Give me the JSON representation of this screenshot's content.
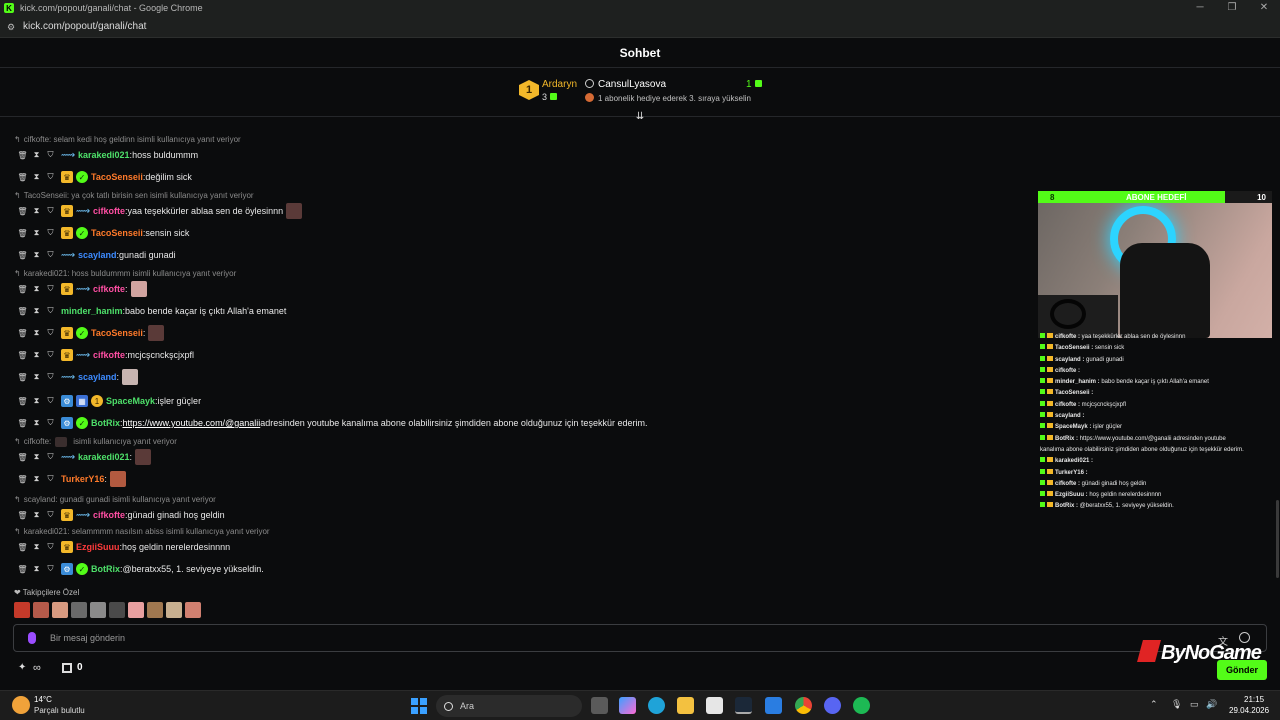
{
  "window": {
    "title": "kick.com/popout/ganali/chat - Google Chrome",
    "url": "kick.com/popout/ganali/chat"
  },
  "header": {
    "title": "Sohbet"
  },
  "gift_banner": {
    "top_gifter": "Ardaryn",
    "top_gifter_rank": "1",
    "top_gifter_count": "3",
    "event_user": "CansulLyasova",
    "event_message": "1 abonelik hediye ederek 3. sıraya yükselin",
    "event_count": "1"
  },
  "colors": {
    "kick_green": "#53fc18",
    "crown_gold": "#f3b82a",
    "background": "#0b0c0d"
  },
  "messages": [
    {
      "type": "reply",
      "text": "cifkofte: selam kedi hoş geldinn isimli kullanıcıya yanıt veriyor"
    },
    {
      "type": "msg",
      "user": "karakedi021",
      "color": "#4ee06a",
      "badges": [
        "sub"
      ],
      "text": "hoss buldummm"
    },
    {
      "type": "msg",
      "user": "TacoSenseii",
      "color": "#ff7a2a",
      "badges": [
        "crown",
        "verified"
      ],
      "text": "değilim sick"
    },
    {
      "type": "reply",
      "text": "TacoSenseii: ya çok tatlı birisin sen isimli kullanıcıya yanıt veriyor"
    },
    {
      "type": "msg",
      "user": "cifkofte",
      "color": "#ff4fa3",
      "badges": [
        "crown",
        "sub"
      ],
      "text": "yaa teşekkürler ablaa sen de öylesinnn"
    },
    {
      "type": "msg",
      "user": "TacoSenseii",
      "color": "#ff7a2a",
      "badges": [
        "crown",
        "verified"
      ],
      "text": "sensin sick"
    },
    {
      "type": "msg",
      "user": "scayland",
      "color": "#3d8bff",
      "badges": [
        "sub"
      ],
      "text": "gunadi gunadi"
    },
    {
      "type": "reply",
      "text": "karakedi021: hoss buldummm isimli kullanıcıya yanıt veriyor"
    },
    {
      "type": "msg",
      "user": "cifkofte",
      "color": "#ff4fa3",
      "badges": [
        "crown",
        "sub"
      ],
      "text": ""
    },
    {
      "type": "msg",
      "user": "minder_hanim",
      "color": "#4ee06a",
      "badges": [],
      "text": "babo bende kaçar iş çıktı Allah'a emanet"
    },
    {
      "type": "msg",
      "user": "TacoSenseii",
      "color": "#ff7a2a",
      "badges": [
        "crown",
        "verified"
      ],
      "text": ""
    },
    {
      "type": "msg",
      "user": "cifkofte",
      "color": "#ff4fa3",
      "badges": [
        "crown",
        "sub"
      ],
      "text": "mcjcşcnckşcjxpfl"
    },
    {
      "type": "msg",
      "user": "scayland",
      "color": "#3d8bff",
      "badges": [
        "sub"
      ],
      "text": ""
    },
    {
      "type": "msg",
      "user": "SpaceMayk",
      "color": "#4ee06a",
      "badges": [
        "bot",
        "blue2",
        "gold"
      ],
      "text": "işler güçler"
    },
    {
      "type": "msg",
      "user": "BotRix",
      "color": "#4ee06a",
      "badges": [
        "bot",
        "verified"
      ],
      "link": "https://www.youtube.com/@ganalii",
      "text": "adresinden youtube kanalıma abone olabilirsiniz şimdiden abone olduğunuz için teşekkür ederim."
    },
    {
      "type": "reply",
      "text": "isimli kullanıcıya yanıt veriyor",
      "prefix": "cifkofte:"
    },
    {
      "type": "msg",
      "user": "karakedi021",
      "color": "#4ee06a",
      "badges": [
        "sub"
      ],
      "text": ""
    },
    {
      "type": "msg",
      "user": "TurkerY16",
      "color": "#ff7a2a",
      "badges": [],
      "text": ""
    },
    {
      "type": "reply",
      "text": "scayland: gunadi gunadi isimli kullanıcıya yanıt veriyor"
    },
    {
      "type": "msg",
      "user": "cifkofte",
      "color": "#ff4fa3",
      "badges": [
        "crown",
        "sub"
      ],
      "text": "günadi ginadi hoş geldin"
    },
    {
      "type": "reply",
      "text": "karakedi021: selammmm nasılsın abiss isimli kullanıcıya yanıt veriyor"
    },
    {
      "type": "msg",
      "user": "EzgiiSuuu",
      "color": "#ff3b3b",
      "badges": [
        "crown"
      ],
      "text": "hoş geldin nerelerdesinnnn"
    },
    {
      "type": "msg",
      "user": "BotRix",
      "color": "#4ee06a",
      "badges": [
        "bot",
        "verified"
      ],
      "text": "@beratxx55, 1. seviyeye yükseldin."
    }
  ],
  "followers_label": "Takipçilere Özel",
  "input": {
    "placeholder": "Bir mesaj gönderin"
  },
  "bottom": {
    "gift_count": "0",
    "send_label": "Gönder",
    "points_symbol": "∞"
  },
  "overlay": {
    "goal_current": "8",
    "goal_title": "ABONE HEDEFİ",
    "goal_target": "10",
    "goal_fraction": 0.8,
    "brand": "ByNoGame",
    "mini_chat": [
      {
        "user": "cifkofte",
        "text": "yaa teşekkürler ablaa sen de öylesinnn"
      },
      {
        "user": "TacoSenseii",
        "text": "sensin sick"
      },
      {
        "user": "scayland",
        "text": "gunadi gunadi"
      },
      {
        "user": "cifkofte",
        "text": ""
      },
      {
        "user": "minder_hanim",
        "text": "babo bende kaçar iş çıktı Allah'a emanet"
      },
      {
        "user": "TacoSenseii",
        "text": ""
      },
      {
        "user": "cifkofte",
        "text": "mcjcşcnckşcjxpfl"
      },
      {
        "user": "scayland",
        "text": ""
      },
      {
        "user": "SpaceMayk",
        "text": "işler güçler"
      },
      {
        "user": "BotRix",
        "text": "https://www.youtube.com/@ganalii adresinden youtube"
      },
      {
        "user": "",
        "text": "kanalıma abone olabilirsiniz şimdiden abone olduğunuz için teşekkür ederim."
      },
      {
        "user": "karakedi021",
        "text": ""
      },
      {
        "user": "TurkerY16",
        "text": ""
      },
      {
        "user": "cifkofte",
        "text": "günadi ginadi hoş geldin"
      },
      {
        "user": "EzgiiSuuu",
        "text": "hoş geldin nerelerdesinnnn"
      },
      {
        "user": "BotRix",
        "text": "@beratxx55, 1. seviyeye yükseldin."
      }
    ]
  },
  "taskbar": {
    "temperature": "14°C",
    "weather": "Parçalı bulutlu",
    "search_placeholder": "Ara",
    "time": "21:15",
    "date": "29.04.2026"
  }
}
